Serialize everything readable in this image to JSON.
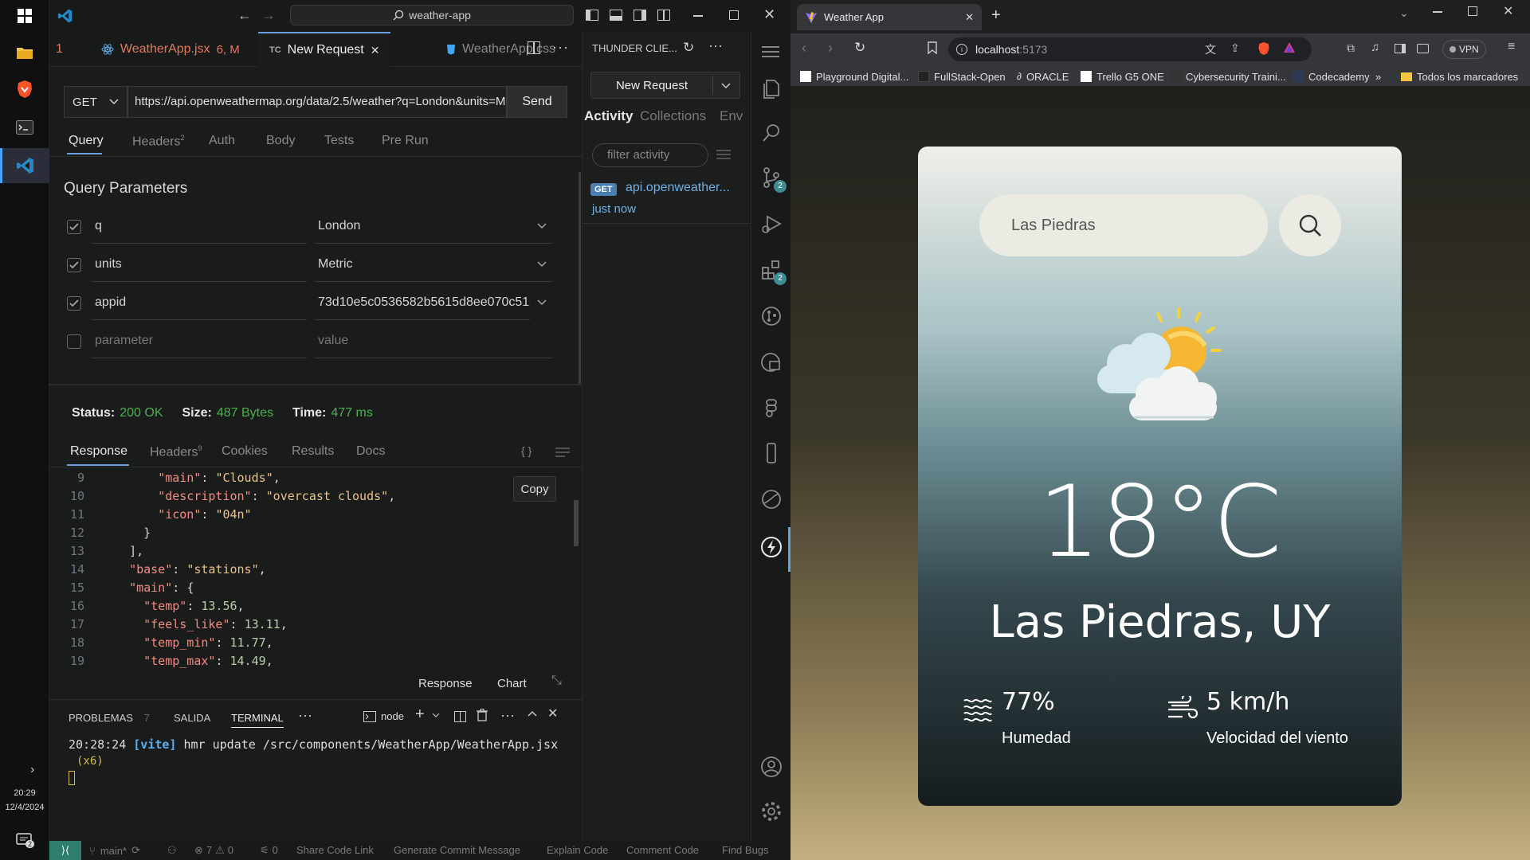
{
  "taskbar": {
    "time": "20:29",
    "date": "12/4/2024",
    "notif_count": "2"
  },
  "vscode": {
    "title_search": "weather-app",
    "tabs": [
      {
        "num": "1",
        "label": "WeatherApp.jsx",
        "badge": "6, M"
      },
      {
        "prefix": "TC",
        "label": "New Request",
        "close": "✕"
      },
      {
        "label": "WeatherApp.css"
      }
    ],
    "request": {
      "method": "GET",
      "url": "https://api.openweathermap.org/data/2.5/weather?q=London&units=Metric&appid=73d10e5c0536582b5615d8ee070c518c",
      "send": "Send",
      "subtabs": [
        "Query",
        "Headers",
        "Auth",
        "Body",
        "Tests",
        "Pre Run"
      ],
      "headers_count": "2",
      "section_title": "Query Parameters",
      "params": [
        {
          "key": "q",
          "value": "London"
        },
        {
          "key": "units",
          "value": "Metric"
        },
        {
          "key": "appid",
          "value": "73d10e5c0536582b5615d8ee070c518c"
        }
      ],
      "param_placeholder": "parameter",
      "value_placeholder": "value"
    },
    "status": {
      "status_label": "Status:",
      "status_value": "200 OK",
      "size_label": "Size:",
      "size_value": "487 Bytes",
      "time_label": "Time:",
      "time_value": "477 ms"
    },
    "response": {
      "tabs": [
        "Response",
        "Headers",
        "Cookies",
        "Results",
        "Docs"
      ],
      "headers_count": "9",
      "copy": "Copy",
      "lines": [
        {
          "n": "9",
          "indent": "      ",
          "key": "\"main\"",
          "val": "\"Clouds\"",
          "type": "s",
          "tail": ","
        },
        {
          "n": "10",
          "indent": "      ",
          "key": "\"description\"",
          "val": "\"overcast clouds\"",
          "type": "s",
          "tail": ","
        },
        {
          "n": "11",
          "indent": "      ",
          "key": "\"icon\"",
          "val": "\"04n\"",
          "type": "s",
          "tail": ""
        },
        {
          "n": "12",
          "indent": "    ",
          "key": "",
          "val": "}",
          "type": "p",
          "tail": ""
        },
        {
          "n": "13",
          "indent": "  ",
          "key": "",
          "val": "],",
          "type": "p",
          "tail": ""
        },
        {
          "n": "14",
          "indent": "  ",
          "key": "\"base\"",
          "val": "\"stations\"",
          "type": "s",
          "tail": ","
        },
        {
          "n": "15",
          "indent": "  ",
          "key": "\"main\"",
          "val": "{",
          "type": "p",
          "tail": ""
        },
        {
          "n": "16",
          "indent": "    ",
          "key": "\"temp\"",
          "val": "13.56",
          "type": "n",
          "tail": ","
        },
        {
          "n": "17",
          "indent": "    ",
          "key": "\"feels_like\"",
          "val": "13.11",
          "type": "n",
          "tail": ","
        },
        {
          "n": "18",
          "indent": "    ",
          "key": "\"temp_min\"",
          "val": "11.77",
          "type": "n",
          "tail": ","
        },
        {
          "n": "19",
          "indent": "    ",
          "key": "\"temp_max\"",
          "val": "14.49",
          "type": "n",
          "tail": ","
        }
      ],
      "bottom_tabs": [
        "Response",
        "Chart"
      ]
    },
    "panel": {
      "tabs": [
        "PROBLEMAS",
        "SALIDA",
        "TERMINAL"
      ],
      "problems_count": "7",
      "shell": "node",
      "terminal_time": "20:28:24",
      "terminal_tag": "[vite]",
      "terminal_msg": "hmr update /src/components/WeatherApp/WeatherApp.jsx",
      "terminal_count": "(x6)"
    },
    "thunder": {
      "title": "THUNDER CLIE...",
      "new_request": "New Request",
      "tabs": [
        "Activity",
        "Collections",
        "Env"
      ],
      "filter_placeholder": "filter activity",
      "activity_method": "GET",
      "activity_url": "api.openweather...",
      "activity_time": "just now"
    },
    "activity_badges": [
      "2",
      "2"
    ],
    "statusbar": {
      "branch": "main*",
      "errors": "7",
      "warnings": "0",
      "ports": "0",
      "items": [
        "Share Code Link",
        "Generate Commit Message",
        "Explain Code",
        "Comment Code",
        "Find Bugs"
      ]
    }
  },
  "browser": {
    "tab_title": "Weather App",
    "address": "localhost",
    "address_port": ":5173",
    "vpn": "VPN",
    "bookmarks": [
      "Playground Digital...",
      "FullStack-Open",
      "ORACLE",
      "Trello G5 ONE",
      "Cybersecurity Traini...",
      "Codecademy"
    ],
    "bookmarks_more": "»",
    "all_bookmarks": "Todos los marcadores",
    "app": {
      "search_value": "Las Piedras",
      "temperature": "18°C",
      "location": "Las Piedras, UY",
      "humidity_value": "77%",
      "humidity_label": "Humedad",
      "wind_value": "5 km/h",
      "wind_label": "Velocidad del viento"
    }
  }
}
